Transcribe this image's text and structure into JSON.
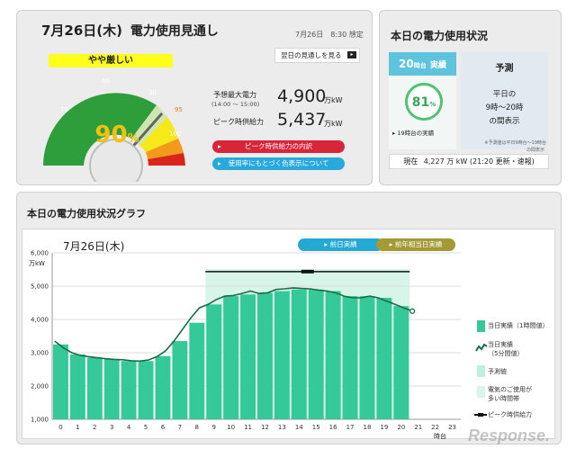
{
  "forecast": {
    "date": "7月26日(木)",
    "title": "電力使用見通し",
    "as_of": "7月26日　8:30 想定",
    "tomorrow_button": "翌日の見通しを見る",
    "status_label": "やや厳しい",
    "gauge_value": "90",
    "gauge_unit": "%",
    "gauge_ticks": [
      "70",
      "80",
      "90",
      "95",
      "100"
    ],
    "peak_demand_label": "予想最大電力",
    "peak_demand_time": "(14:00 ～ 15:00)",
    "peak_demand_value": "4,900",
    "peak_supply_label": "ピーク時供給力",
    "peak_supply_value": "5,437",
    "unit": "万kW",
    "breakdown_button": "ピーク時供給力の内訳",
    "color_button": "使用率にもとづく色表示について"
  },
  "today_status": {
    "title": "本日の電力使用状況",
    "actual_tab_hour": "20",
    "actual_tab_suffix": "時台",
    "actual_tab_label": "実績",
    "actual_percent": "81",
    "actual_percent_unit": "%",
    "actual_note": "19時台の実績",
    "forecast_tab_label": "予測",
    "forecast_text_1": "平日の",
    "forecast_text_2": "9時～20時",
    "forecast_text_3": "の間表示",
    "forecast_note_1": "※予測値は平日9時台～19時台",
    "forecast_note_2": "の間表示",
    "current_label": "現在",
    "current_value": "4,227",
    "current_unit": "万 kW",
    "current_update": "(21:20 更新・速報)"
  },
  "graph_panel": {
    "title": "本日の電力使用状況グラフ",
    "date": "7月26日(木)",
    "prev_day_button": "前日実績",
    "last_year_button": "前年相当日実績",
    "y_unit": "万kW",
    "x_unit": "時台",
    "legend": {
      "hourly": "当日実績（1時間値）",
      "fivemin_1": "当日実績",
      "fivemin_2": "（5分間値）",
      "forecast": "予測値",
      "busy_1": "電気のご使用が",
      "busy_2": "多い時間帯",
      "peak": "ピーク時供給力"
    },
    "colors": {
      "bar": "#35c99a",
      "busy": "#d8f5ea",
      "line": "#1e6b47",
      "peak": "#111111"
    }
  },
  "chart_data": {
    "type": "bar",
    "title": "本日の電力使用状況グラフ",
    "xlabel": "時台",
    "ylabel": "万kW",
    "ylim": [
      1000,
      6000
    ],
    "yticks": [
      "1,000",
      "2,000",
      "3,000",
      "4,000",
      "5,000",
      "6,000"
    ],
    "categories": [
      "0",
      "1",
      "2",
      "3",
      "4",
      "5",
      "6",
      "7",
      "8",
      "9",
      "10",
      "11",
      "12",
      "13",
      "14",
      "15",
      "16",
      "17",
      "18",
      "19",
      "20",
      "21",
      "22",
      "23"
    ],
    "series": [
      {
        "name": "当日実績（1時間値）",
        "type": "bar",
        "values": [
          3250,
          2950,
          2850,
          2800,
          2750,
          2750,
          2900,
          3350,
          3900,
          4450,
          4700,
          4750,
          4800,
          4850,
          4900,
          4900,
          4850,
          4700,
          4700,
          4650,
          4400,
          null,
          null,
          null
        ]
      },
      {
        "name": "当日実績（5分間値）",
        "type": "line",
        "x": [
          0,
          0.5,
          1,
          1.5,
          2,
          2.5,
          3,
          3.5,
          4,
          4.5,
          5,
          5.5,
          6,
          6.5,
          7,
          7.5,
          8,
          8.5,
          9,
          9.5,
          10,
          10.5,
          11,
          11.5,
          12,
          12.5,
          13,
          13.5,
          14,
          14.5,
          15,
          15.5,
          16,
          16.5,
          17,
          17.5,
          18,
          18.5,
          19,
          19.5,
          20,
          20.5,
          21
        ],
        "values": [
          3350,
          3150,
          3000,
          2920,
          2880,
          2850,
          2820,
          2800,
          2790,
          2760,
          2750,
          2780,
          2880,
          3050,
          3350,
          3700,
          4050,
          4350,
          4450,
          4600,
          4700,
          4720,
          4780,
          4850,
          4780,
          4800,
          4900,
          4920,
          4950,
          4930,
          4920,
          4880,
          4850,
          4800,
          4700,
          4650,
          4650,
          4700,
          4650,
          4550,
          4450,
          4350,
          4250
        ]
      }
    ],
    "peak_supply": {
      "name": "ピーク時供給力",
      "value": 5437,
      "from": 9,
      "to": 20
    },
    "busy_period": {
      "name": "電気のご使用が多い時間帯",
      "from": 9,
      "to": 20
    },
    "grid": true,
    "legend_position": "right"
  }
}
